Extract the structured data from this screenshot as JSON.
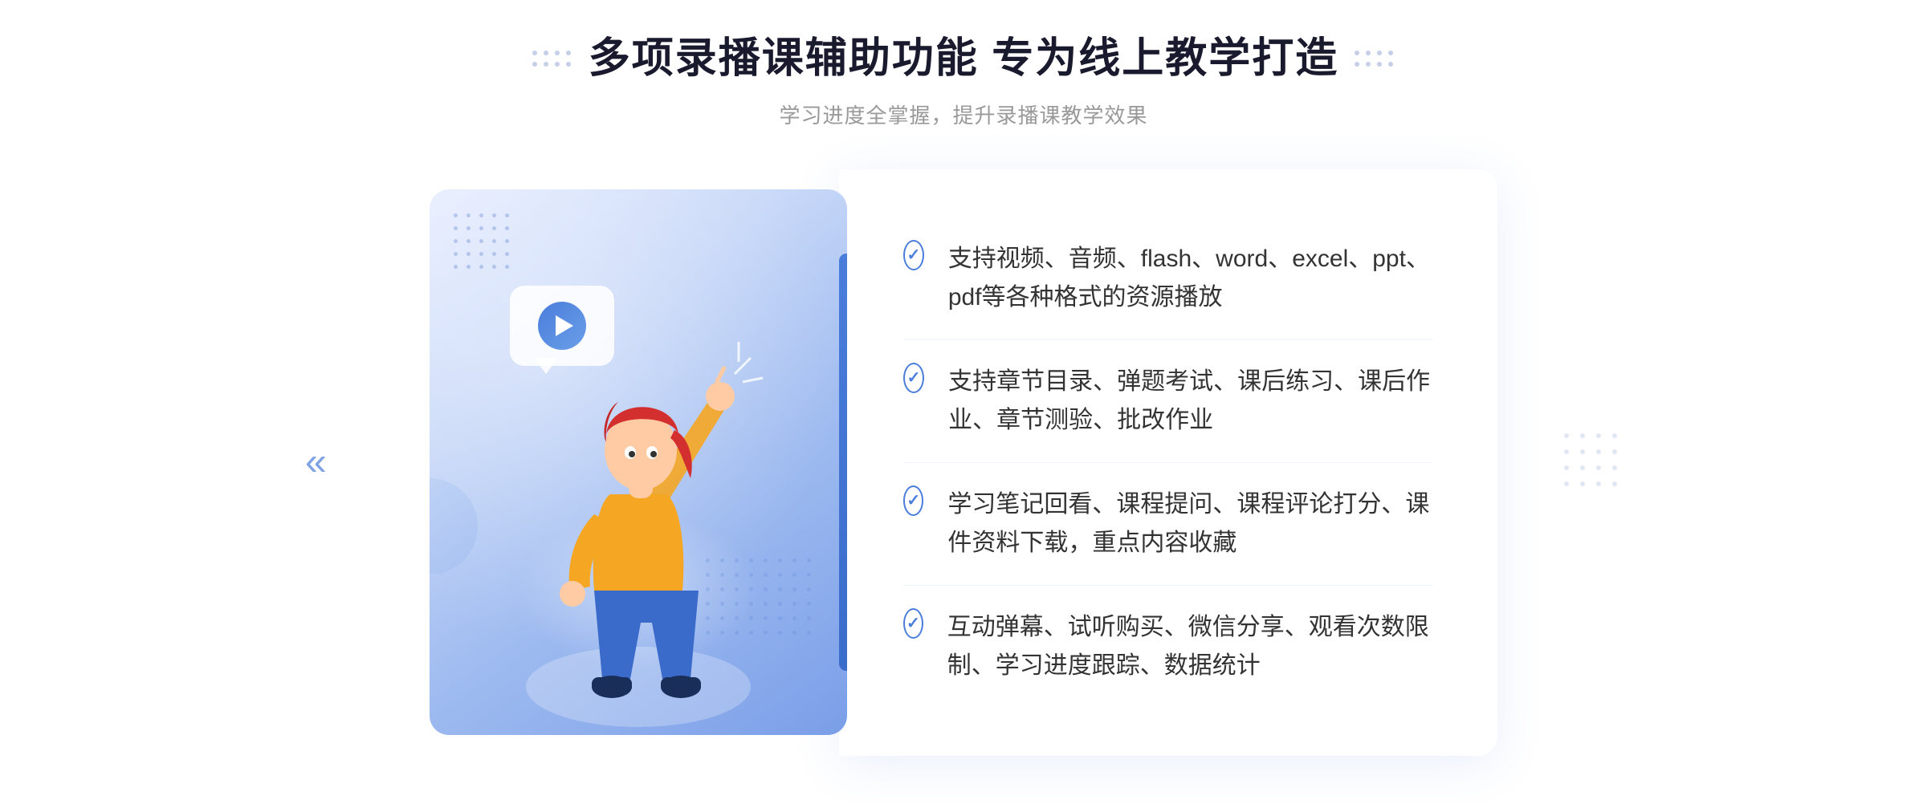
{
  "header": {
    "main_title": "多项录播课辅助功能 专为线上教学打造",
    "subtitle": "学习进度全掌握，提升录播课教学效果"
  },
  "features": [
    {
      "id": 1,
      "text": "支持视频、音频、flash、word、excel、ppt、pdf等各种格式的资源播放"
    },
    {
      "id": 2,
      "text": "支持章节目录、弹题考试、课后练习、课后作业、章节测验、批改作业"
    },
    {
      "id": 3,
      "text": "学习笔记回看、课程提问、课程评论打分、课件资料下载，重点内容收藏"
    },
    {
      "id": 4,
      "text": "互动弹幕、试听购买、微信分享、观看次数限制、学习进度跟踪、数据统计"
    }
  ],
  "decoration": {
    "left_chevron": "«",
    "check_mark": "✓"
  }
}
